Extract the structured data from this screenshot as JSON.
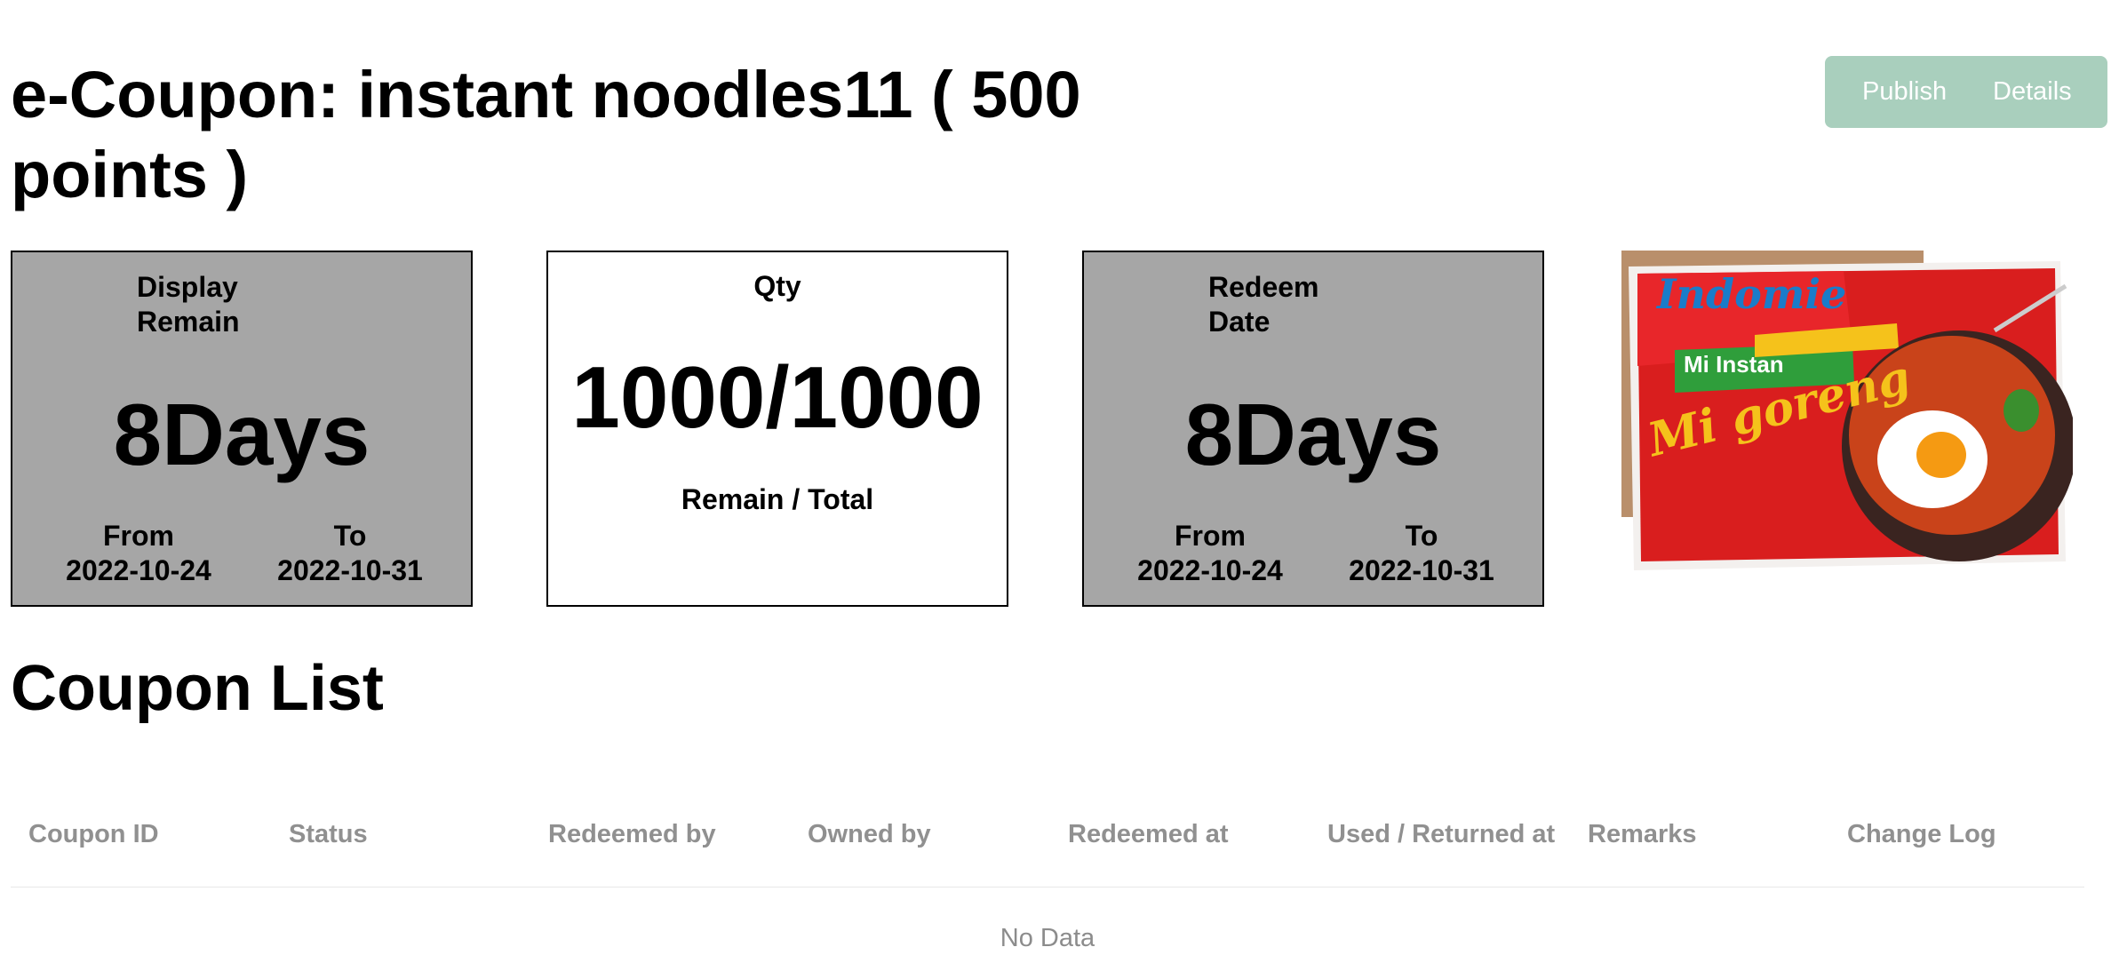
{
  "page": {
    "title": "e-Coupon: instant noodles11 ( 500 points )"
  },
  "actions": {
    "publish_label": "Publish",
    "details_label": "Details",
    "accent_color": "#a9cfbd"
  },
  "display_card": {
    "heading_line1": "Display",
    "heading_line2": "Remain",
    "value": "8Days",
    "from_label": "From",
    "from_date": "2022-10-24",
    "to_label": "To",
    "to_date": "2022-10-31"
  },
  "qty_card": {
    "heading": "Qty",
    "value": "1000/1000",
    "caption": "Remain / Total"
  },
  "redeem_card": {
    "heading_line1": "Redeem",
    "heading_line2": "Date",
    "value": "8Days",
    "from_label": "From",
    "from_date": "2022-10-24",
    "to_label": "To",
    "to_date": "2022-10-31"
  },
  "product_image": {
    "brand": "Indomie",
    "variant": "Mi Instan",
    "flavor": "Mi goreng"
  },
  "coupon_list": {
    "title": "Coupon List",
    "columns": [
      "Coupon ID",
      "Status",
      "Redeemed by",
      "Owned by",
      "Redeemed at",
      "Used / Returned at",
      "Remarks",
      "Change Log"
    ],
    "empty_text": "No Data"
  }
}
